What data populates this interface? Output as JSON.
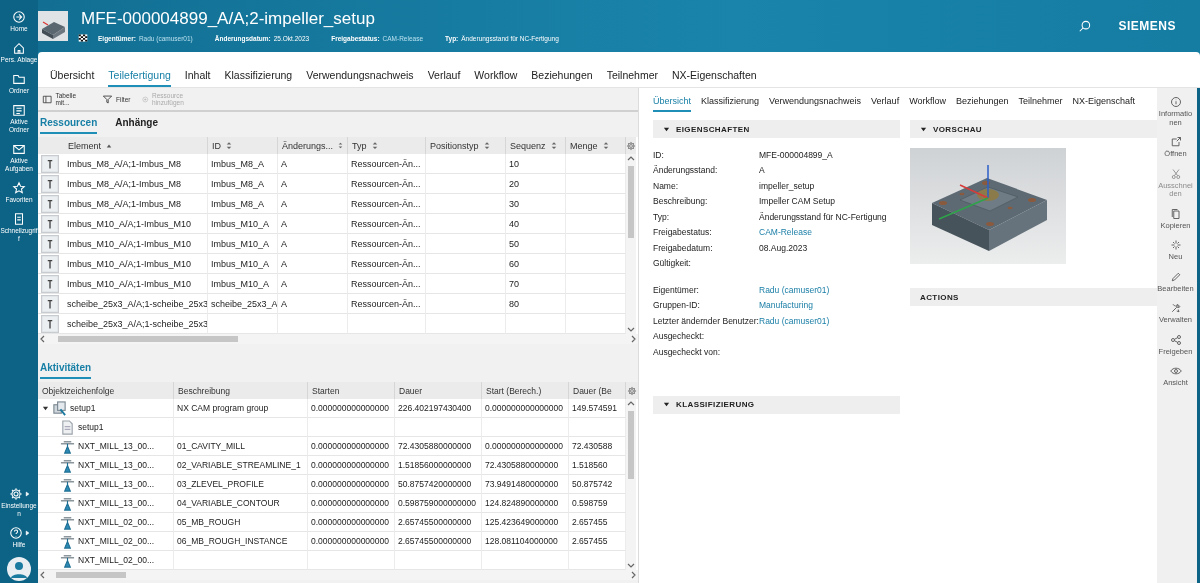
{
  "nav": [
    {
      "label": "Home"
    },
    {
      "label": "Pers. Ablage"
    },
    {
      "label": "Ordner"
    },
    {
      "label": "Aktive Ordner"
    },
    {
      "label": "Aktive Aufgaben"
    },
    {
      "label": "Favoriten"
    },
    {
      "label": "Schnellzugriff"
    }
  ],
  "nav_bottom": [
    {
      "label": "Einstellungen"
    },
    {
      "label": "Hilfe"
    }
  ],
  "header": {
    "title": "MFE-000004899_A/A;2-impeller_setup",
    "brand": "SIEMENS",
    "meta": [
      {
        "label": "Eigentümer:",
        "value": "Radu (camuser01)",
        "link": true
      },
      {
        "label": "Änderungsdatum:",
        "value": "25.Okt.2023",
        "link": false
      },
      {
        "label": "Freigabestatus:",
        "value": "CAM-Release",
        "link": true
      },
      {
        "label": "Typ:",
        "value": "Änderungsstand für NC-Fertigung",
        "link": false
      }
    ]
  },
  "main_tabs": [
    {
      "label": "Übersicht",
      "selected": false
    },
    {
      "label": "Teilefertigung",
      "selected": true
    },
    {
      "label": "Inhalt",
      "selected": false
    },
    {
      "label": "Klassifizierung",
      "selected": false
    },
    {
      "label": "Verwendungsnachweis",
      "selected": false
    },
    {
      "label": "Verlauf",
      "selected": false
    },
    {
      "label": "Workflow",
      "selected": false
    },
    {
      "label": "Beziehungen",
      "selected": false
    },
    {
      "label": "Teilnehmer",
      "selected": false
    },
    {
      "label": "NX-Eigenschaften",
      "selected": false
    }
  ],
  "toolbar": [
    {
      "label": "Tabelle mit...",
      "disabled": false
    },
    {
      "label": "Filter",
      "disabled": false
    },
    {
      "label": "Ressource hinzufügen",
      "disabled": true
    }
  ],
  "resource_tabs": [
    {
      "label": "Ressourcen",
      "selected": true
    },
    {
      "label": "Anhänge",
      "selected": false
    }
  ],
  "resources": {
    "columns": [
      {
        "label": "Element",
        "sorted": true
      },
      {
        "label": "ID",
        "sorted": false
      },
      {
        "label": "Änderungs...",
        "sorted": false
      },
      {
        "label": "Typ",
        "sorted": false
      },
      {
        "label": "Positionstyp",
        "sorted": false
      },
      {
        "label": "Sequenz",
        "sorted": false
      },
      {
        "label": "Menge",
        "sorted": false
      }
    ],
    "rows": [
      [
        "Imbus_M8_A/A;1-Imbus_M8",
        "Imbus_M8_A",
        "A",
        "Ressourcen-Än...",
        "",
        "10",
        ""
      ],
      [
        "Imbus_M8_A/A;1-Imbus_M8",
        "Imbus_M8_A",
        "A",
        "Ressourcen-Än...",
        "",
        "20",
        ""
      ],
      [
        "Imbus_M8_A/A;1-Imbus_M8",
        "Imbus_M8_A",
        "A",
        "Ressourcen-Än...",
        "",
        "30",
        ""
      ],
      [
        "Imbus_M10_A/A;1-Imbus_M10",
        "Imbus_M10_A",
        "A",
        "Ressourcen-Än...",
        "",
        "40",
        ""
      ],
      [
        "Imbus_M10_A/A;1-Imbus_M10",
        "Imbus_M10_A",
        "A",
        "Ressourcen-Än...",
        "",
        "50",
        ""
      ],
      [
        "Imbus_M10_A/A;1-Imbus_M10",
        "Imbus_M10_A",
        "A",
        "Ressourcen-Än...",
        "",
        "60",
        ""
      ],
      [
        "Imbus_M10_A/A;1-Imbus_M10",
        "Imbus_M10_A",
        "A",
        "Ressourcen-Än...",
        "",
        "70",
        ""
      ],
      [
        "scheibe_25x3_A/A;1-scheibe_25x3",
        "scheibe_25x3_A",
        "A",
        "Ressourcen-Än...",
        "",
        "80",
        ""
      ],
      [
        "scheibe_25x3_A/A;1-scheibe_25x3",
        "",
        "",
        "",
        "",
        "",
        ""
      ]
    ]
  },
  "activity_tabs": [
    {
      "label": "Aktivitäten",
      "selected": true
    }
  ],
  "activities": {
    "columns": [
      "Objektzeichenfolge",
      "Beschreibung",
      "Starten",
      "Dauer",
      "Start (Berech.)",
      "Dauer (Be"
    ],
    "rows": [
      {
        "kind": "group",
        "expanded": true,
        "cells": [
          "setup1",
          "NX CAM program group",
          "0.000000000000000",
          "226.402197430400",
          "0.000000000000000",
          "149.574591"
        ],
        "children": [
          {
            "kind": "document",
            "cells": [
              "setup1",
              "",
              "",
              "",
              "",
              ""
            ]
          },
          {
            "kind": "operation",
            "cells": [
              "NXT_MILL_13_00...",
              "01_CAVITY_MILL",
              "0.000000000000000",
              "72.4305880000000",
              "0.000000000000000",
              "72.430588"
            ]
          },
          {
            "kind": "operation",
            "cells": [
              "NXT_MILL_13_00...",
              "02_VARIABLE_STREAMLINE_1",
              "0.000000000000000",
              "1.51856000000000",
              "72.4305880000000",
              "1.518560"
            ]
          },
          {
            "kind": "operation",
            "cells": [
              "NXT_MILL_13_00...",
              "03_ZLEVEL_PROFILE",
              "0.000000000000000",
              "50.8757420000000",
              "73.9491480000000",
              "50.875742"
            ]
          },
          {
            "kind": "operation",
            "cells": [
              "NXT_MILL_13_00...",
              "04_VARIABLE_CONTOUR",
              "0.000000000000000",
              "0.598759000000000",
              "124.824890000000",
              "0.598759"
            ]
          },
          {
            "kind": "operation",
            "cells": [
              "NXT_MILL_02_00...",
              "05_MB_ROUGH",
              "0.000000000000000",
              "2.65745500000000",
              "125.423649000000",
              "2.657455"
            ]
          },
          {
            "kind": "operation",
            "cells": [
              "NXT_MILL_02_00...",
              "06_MB_ROUGH_INSTANCE",
              "0.000000000000000",
              "2.65745500000000",
              "128.081104000000",
              "2.657455"
            ]
          },
          {
            "kind": "operation",
            "cells": [
              "NXT_MILL_02_00...",
              "",
              "",
              "",
              "",
              ""
            ]
          }
        ]
      }
    ]
  },
  "detail_tabs": [
    {
      "label": "Übersicht",
      "selected": true
    },
    {
      "label": "Klassifizierung",
      "selected": false
    },
    {
      "label": "Verwendungsnachweis",
      "selected": false
    },
    {
      "label": "Verlauf",
      "selected": false
    },
    {
      "label": "Workflow",
      "selected": false
    },
    {
      "label": "Beziehungen",
      "selected": false
    },
    {
      "label": "Teilnehmer",
      "selected": false
    },
    {
      "label": "NX-Eigenschaft",
      "selected": false
    }
  ],
  "properties": {
    "title": "EIGENSCHAFTEN",
    "expanded": true,
    "field_groups": [
      [
        {
          "label": "ID:",
          "value": "MFE-000004899_A",
          "link": false
        },
        {
          "label": "Änderungsstand:",
          "value": "A",
          "link": false
        },
        {
          "label": "Name:",
          "value": "impeller_setup",
          "link": false
        },
        {
          "label": "Beschreibung:",
          "value": "Impeller CAM Setup",
          "link": false
        },
        {
          "label": "Typ:",
          "value": "Änderungsstand für NC-Fertigung",
          "link": false
        },
        {
          "label": "Freigabestatus:",
          "value": "CAM-Release",
          "link": true
        },
        {
          "label": "Freigabedatum:",
          "value": "08.Aug.2023",
          "link": false
        },
        {
          "label": "Gültigkeit:"
        }
      ],
      [
        {
          "label": "Eigentümer:",
          "value": "Radu (camuser01)",
          "link": true
        },
        {
          "label": "Gruppen-ID:",
          "value": "Manufacturing",
          "link": true
        },
        {
          "label": "Letzter ändernder Benutzer:",
          "value": "Radu (camuser01)",
          "link": true
        },
        {
          "label": "Ausgecheckt:"
        },
        {
          "label": "Ausgecheckt von:"
        }
      ]
    ]
  },
  "classification": {
    "title": "KLASSIFIZIERUNG",
    "expanded": true
  },
  "preview": {
    "title": "VORSCHAU",
    "expanded": true
  },
  "actions": {
    "title": "ACTIONS"
  },
  "rail": [
    {
      "label": "Informationen",
      "disabled": false
    },
    {
      "label": "Öffnen",
      "disabled": false
    },
    {
      "label": "Ausschneiden",
      "disabled": true
    },
    {
      "label": "Kopieren",
      "disabled": false
    },
    {
      "label": "Neu",
      "disabled": false
    },
    {
      "label": "Bearbeiten",
      "disabled": false
    },
    {
      "label": "Verwalten",
      "disabled": false
    },
    {
      "label": "Freigeben",
      "disabled": false
    },
    {
      "label": "Ansicht",
      "disabled": false
    }
  ]
}
